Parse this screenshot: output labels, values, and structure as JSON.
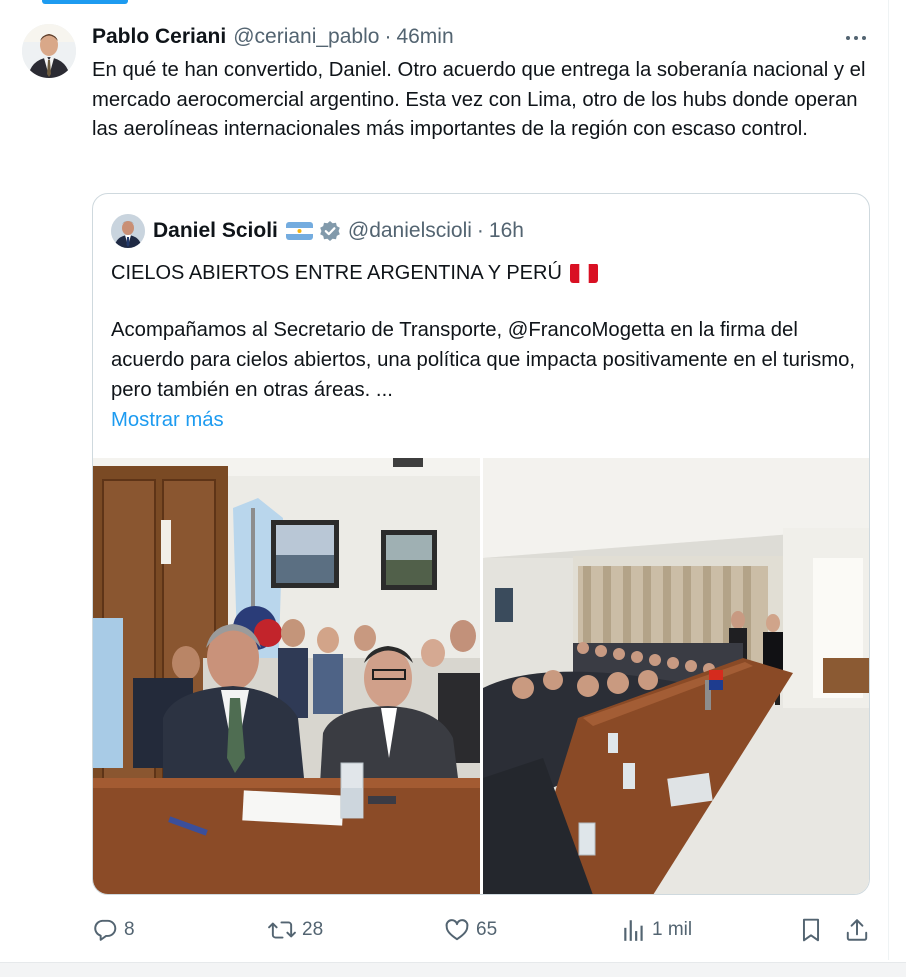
{
  "tweet": {
    "author_name": "Pablo Ceriani",
    "author_handle": "@ceriani_pablo",
    "separator": "·",
    "timestamp": "46min",
    "text": "En qué te han convertido, Daniel. Otro acuerdo que entrega la soberanía nacional y el mercado aerocomercial argentino. Esta vez con Lima, otro de los hubs donde operan las aerolíneas internacionales más importantes de la región con escaso control.",
    "avatar_icon": "profile-photo"
  },
  "quote": {
    "author_name": "Daniel Scioli",
    "author_flag_icon": "argentina-flag",
    "verified_icon": "verified-badge",
    "author_handle": "@danielscioli",
    "separator": "·",
    "timestamp": "16h",
    "title": "CIELOS ABIERTOS ENTRE ARGENTINA Y PERÚ",
    "title_flag_icon": "peru-flag",
    "body": "Acompañamos al Secretario de Transporte, @FrancoMogetta en la firma del acuerdo para cielos abiertos, una política que impacta positivamente en el turismo, pero también en otras áreas. ...",
    "show_more": "Mostrar más"
  },
  "actions": {
    "replies": "8",
    "reposts": "28",
    "likes": "65",
    "views": "1 mil",
    "icons": [
      "reply-icon",
      "repost-icon",
      "like-icon",
      "views-icon",
      "bookmark-icon",
      "share-icon"
    ]
  },
  "colors": {
    "text": "#0f1419",
    "secondary": "#536471",
    "link": "#1d9bf0",
    "border": "#cfd9de"
  }
}
